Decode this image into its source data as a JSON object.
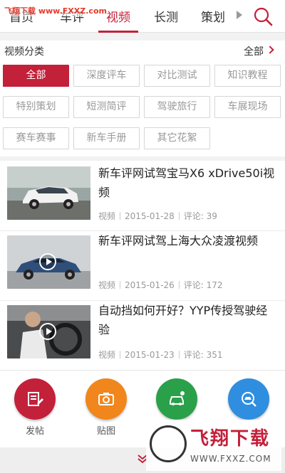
{
  "watermark_top": "飞翔下载 www.FXXZ.com",
  "nav": {
    "tabs": [
      {
        "label": "首页"
      },
      {
        "label": "车评"
      },
      {
        "label": "视频"
      },
      {
        "label": "长测"
      },
      {
        "label": "策划"
      }
    ],
    "active_tab": "视频"
  },
  "category": {
    "header": "视频分类",
    "all_link": "全部",
    "chips": [
      "全部",
      "深度评车",
      "对比测试",
      "知识教程",
      "特别策划",
      "短测简评",
      "驾驶旅行",
      "车展现场",
      "赛车赛事",
      "新车手册",
      "其它花絮"
    ],
    "active_chip": "全部"
  },
  "videos": [
    {
      "title": "新车评网试驾宝马X6 xDrive50i视频",
      "type": "视频",
      "date": "2015-01-28",
      "comments": "评论: 39"
    },
    {
      "title": "新车评网试驾上海大众凌渡视频",
      "type": "视频",
      "date": "2015-01-26",
      "comments": "评论: 172"
    },
    {
      "title": "自动挡如何开好？YYP传授驾驶经验",
      "type": "视频",
      "date": "2015-01-23",
      "comments": "评论: 351"
    }
  ],
  "actions": [
    {
      "label": "发帖",
      "color": "#c3203a",
      "icon": "post-icon"
    },
    {
      "label": "贴图",
      "color": "#f0861c",
      "icon": "camera-icon"
    },
    {
      "label": "",
      "color": "#2aa04a",
      "icon": "car-icon"
    },
    {
      "label": "",
      "color": "#2f8ee0",
      "icon": "car-search-icon"
    }
  ],
  "watermark_bottom": {
    "cn": "飞翔下载",
    "url": "WWW.FXXZ.COM"
  },
  "colors": {
    "accent": "#c3203a",
    "muted_text": "#999999"
  }
}
